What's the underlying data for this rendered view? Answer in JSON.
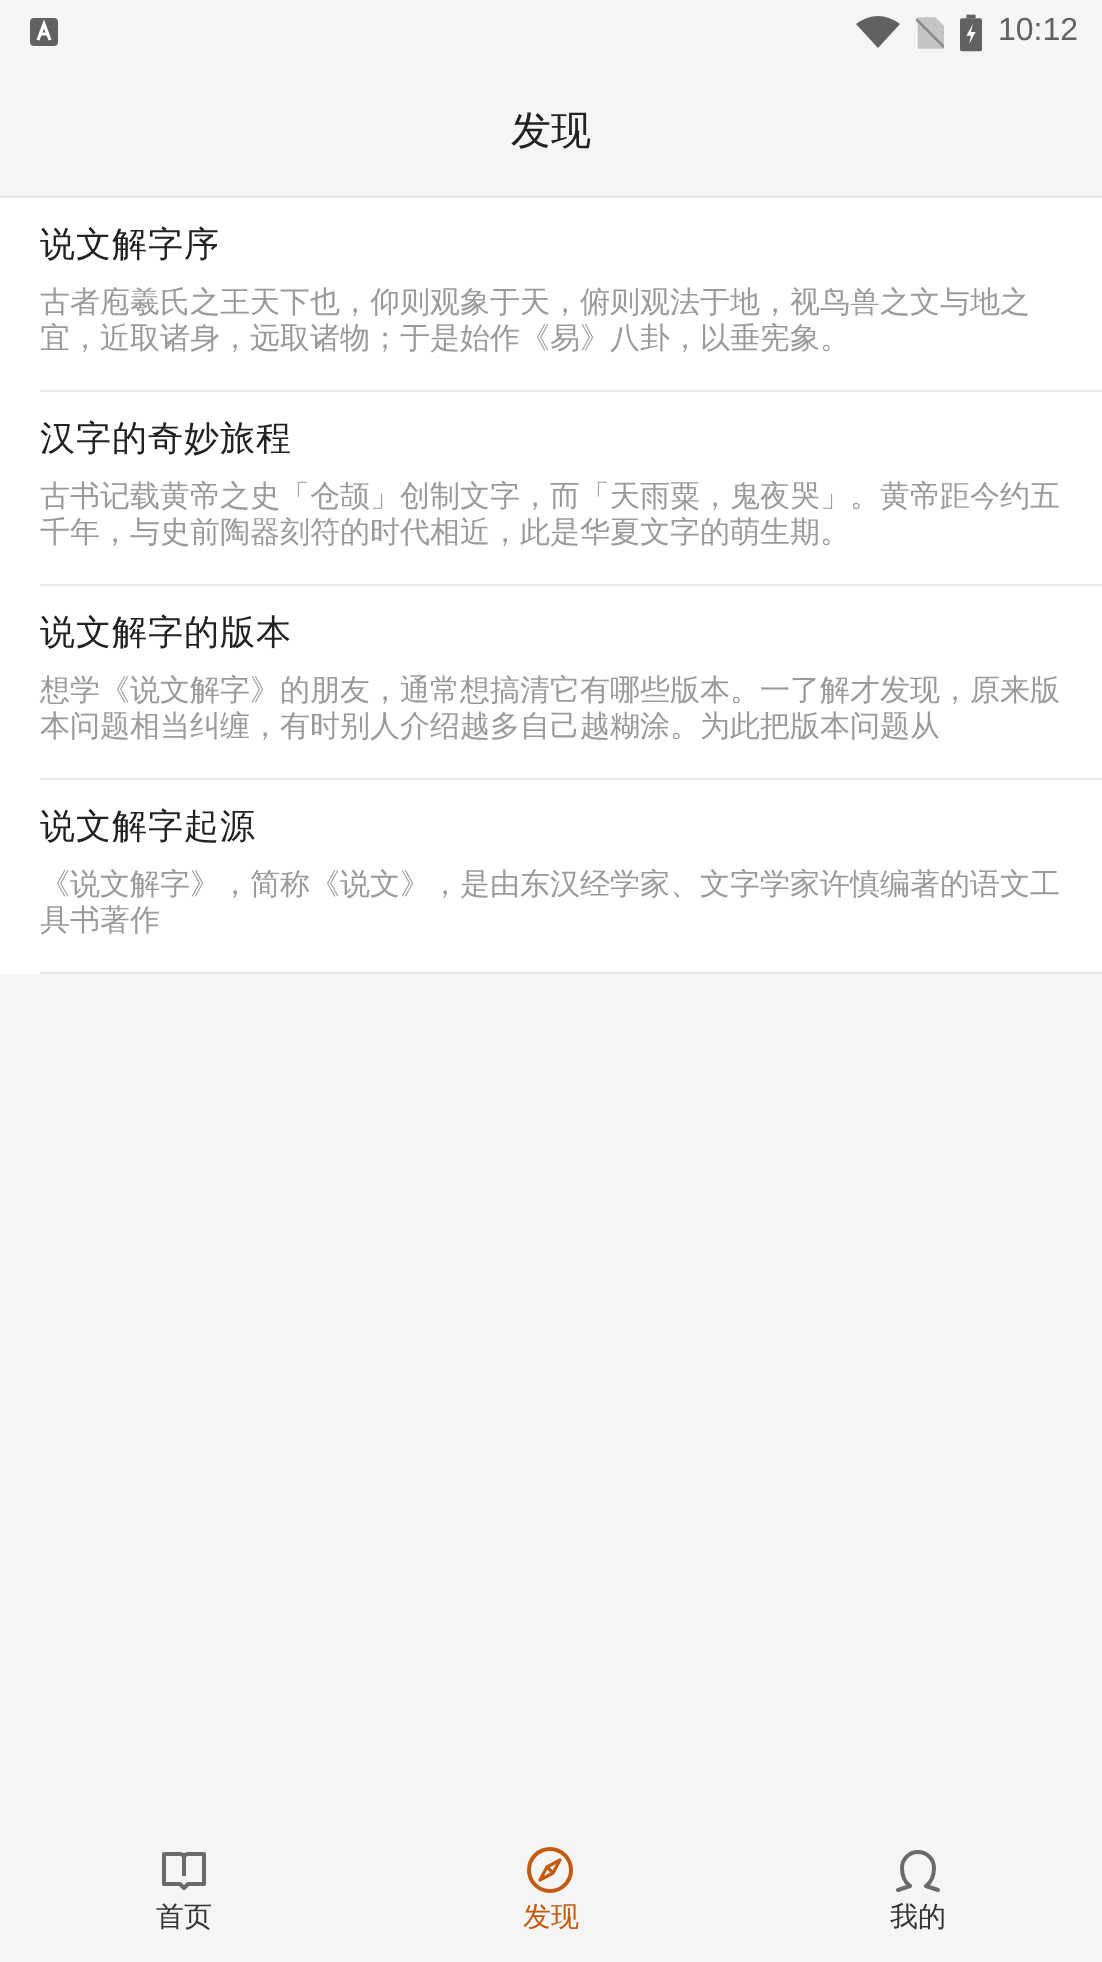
{
  "status_bar": {
    "time": "10:12"
  },
  "header": {
    "title": "发现"
  },
  "articles": [
    {
      "title": "说文解字序",
      "summary": "古者庖羲氏之王天下也，仰则观象于天，俯则观法于地，视鸟兽之文与地之宜，近取诸身，远取诸物；于是始作《易》八卦，以垂宪象。"
    },
    {
      "title": "汉字的奇妙旅程",
      "summary": "古书记载黄帝之史「仓颉」创制文字，而「天雨粟，鬼夜哭」。黄帝距今约五千年，与史前陶器刻符的时代相近，此是华夏文字的萌生期。"
    },
    {
      "title": "说文解字的版本",
      "summary": "想学《说文解字》的朋友，通常想搞清它有哪些版本。一了解才发现，原来版本问题相当纠缠，有时别人介绍越多自己越糊涂。为此把版本问题从"
    },
    {
      "title": "说文解字起源",
      "summary": "《说文解字》，简称《说文》，是由东汉经学家、文字学家许慎编著的语文工具书著作"
    }
  ],
  "tabs": [
    {
      "kind": "book",
      "label": "首页",
      "selected": false
    },
    {
      "kind": "compass",
      "label": "发现",
      "selected": true
    },
    {
      "kind": "person",
      "label": "我的",
      "selected": false
    }
  ]
}
